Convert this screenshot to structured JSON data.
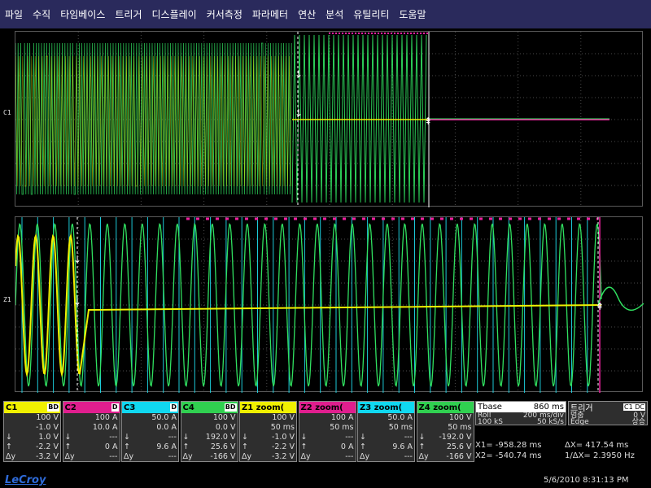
{
  "menu": [
    "파일",
    "수직",
    "타임베이스",
    "트리거",
    "디스플레이",
    "커서측정",
    "파라메터",
    "연산",
    "분석",
    "유틸리티",
    "도움말"
  ],
  "markers": {
    "top": "C1",
    "bottom": "Z1"
  },
  "colors": {
    "c1": "#f0f000",
    "c2": "#f020a0",
    "c3": "#20e0f0",
    "c4": "#30e060",
    "grid": "#5a5a5a"
  },
  "channels": [
    {
      "name": "C1",
      "badge": "BD",
      "hdr_bg": "#f0f000",
      "hdr_fg": "#000",
      "rows": [
        [
          "",
          "100 V"
        ],
        [
          "",
          "-1.0 V"
        ],
        [
          "↓",
          "1.0 V"
        ],
        [
          "↑",
          "-2.2 V"
        ],
        [
          "Δy",
          "-3.2 V"
        ]
      ]
    },
    {
      "name": "C2",
      "badge": "D",
      "hdr_bg": "#e01e8e",
      "hdr_fg": "#000",
      "rows": [
        [
          "",
          "100 A"
        ],
        [
          "",
          "10.0 A"
        ],
        [
          "↓",
          "---"
        ],
        [
          "↑",
          "0 A"
        ],
        [
          "Δy",
          "---"
        ]
      ]
    },
    {
      "name": "C3",
      "badge": "D",
      "hdr_bg": "#10d8f0",
      "hdr_fg": "#000",
      "rows": [
        [
          "",
          "50.0 A"
        ],
        [
          "",
          "0.0 A"
        ],
        [
          "↓",
          "---"
        ],
        [
          "↑",
          "9.6 A"
        ],
        [
          "Δy",
          "---"
        ]
      ]
    },
    {
      "name": "C4",
      "badge": "BD",
      "hdr_bg": "#30d050",
      "hdr_fg": "#000",
      "rows": [
        [
          "",
          "100 V"
        ],
        [
          "",
          "0.0 V"
        ],
        [
          "↓",
          "192.0 V"
        ],
        [
          "↑",
          "25.6 V"
        ],
        [
          "Δy",
          "-166 V"
        ]
      ]
    },
    {
      "name": "Z1 zoom(",
      "badge": "",
      "hdr_bg": "#f0f000",
      "hdr_fg": "#000",
      "rows": [
        [
          "",
          "100 V"
        ],
        [
          "",
          "50 ms"
        ],
        [
          "↓",
          "-1.0 V"
        ],
        [
          "↑",
          "-2.2 V"
        ],
        [
          "Δy",
          "-3.2 V"
        ]
      ]
    },
    {
      "name": "Z2 zoom(",
      "badge": "",
      "hdr_bg": "#e01e8e",
      "hdr_fg": "#000",
      "rows": [
        [
          "",
          "100 A"
        ],
        [
          "",
          "50 ms"
        ],
        [
          "↓",
          "---"
        ],
        [
          "↑",
          "0 A"
        ],
        [
          "Δy",
          "---"
        ]
      ]
    },
    {
      "name": "Z3 zoom(",
      "badge": "",
      "hdr_bg": "#10d8f0",
      "hdr_fg": "#000",
      "rows": [
        [
          "",
          "50.0 A"
        ],
        [
          "",
          "50 ms"
        ],
        [
          "↓",
          "---"
        ],
        [
          "↑",
          "9.6 A"
        ],
        [
          "Δy",
          "---"
        ]
      ]
    },
    {
      "name": "Z4 zoom(",
      "badge": "",
      "hdr_bg": "#30d050",
      "hdr_fg": "#000",
      "rows": [
        [
          "",
          "100 V"
        ],
        [
          "",
          "50 ms"
        ],
        [
          "↓",
          "-192.0 V"
        ],
        [
          "↑",
          "25.6 V"
        ],
        [
          "Δy",
          "-166 V"
        ]
      ]
    }
  ],
  "timebase": {
    "label": "Tbase",
    "value": "860 ms",
    "mode": "Roll",
    "per_div": "200 ms/div",
    "samples": "100 kS",
    "rate": "50 kS/s"
  },
  "trigger": {
    "label": "트리거",
    "badge": "C1 DC",
    "state": "멈춤",
    "level": "0 V",
    "type": "Edge",
    "slope": "상승"
  },
  "cursors": {
    "x1": "X1= -958.28 ms",
    "dx": "ΔX= 417.54 ms",
    "x2": "X2= -540.74 ms",
    "inv_dx": "1/ΔX= 2.3950 Hz"
  },
  "brand": "LeCroy",
  "datetime": "5/6/2010 8:31:13 PM"
}
